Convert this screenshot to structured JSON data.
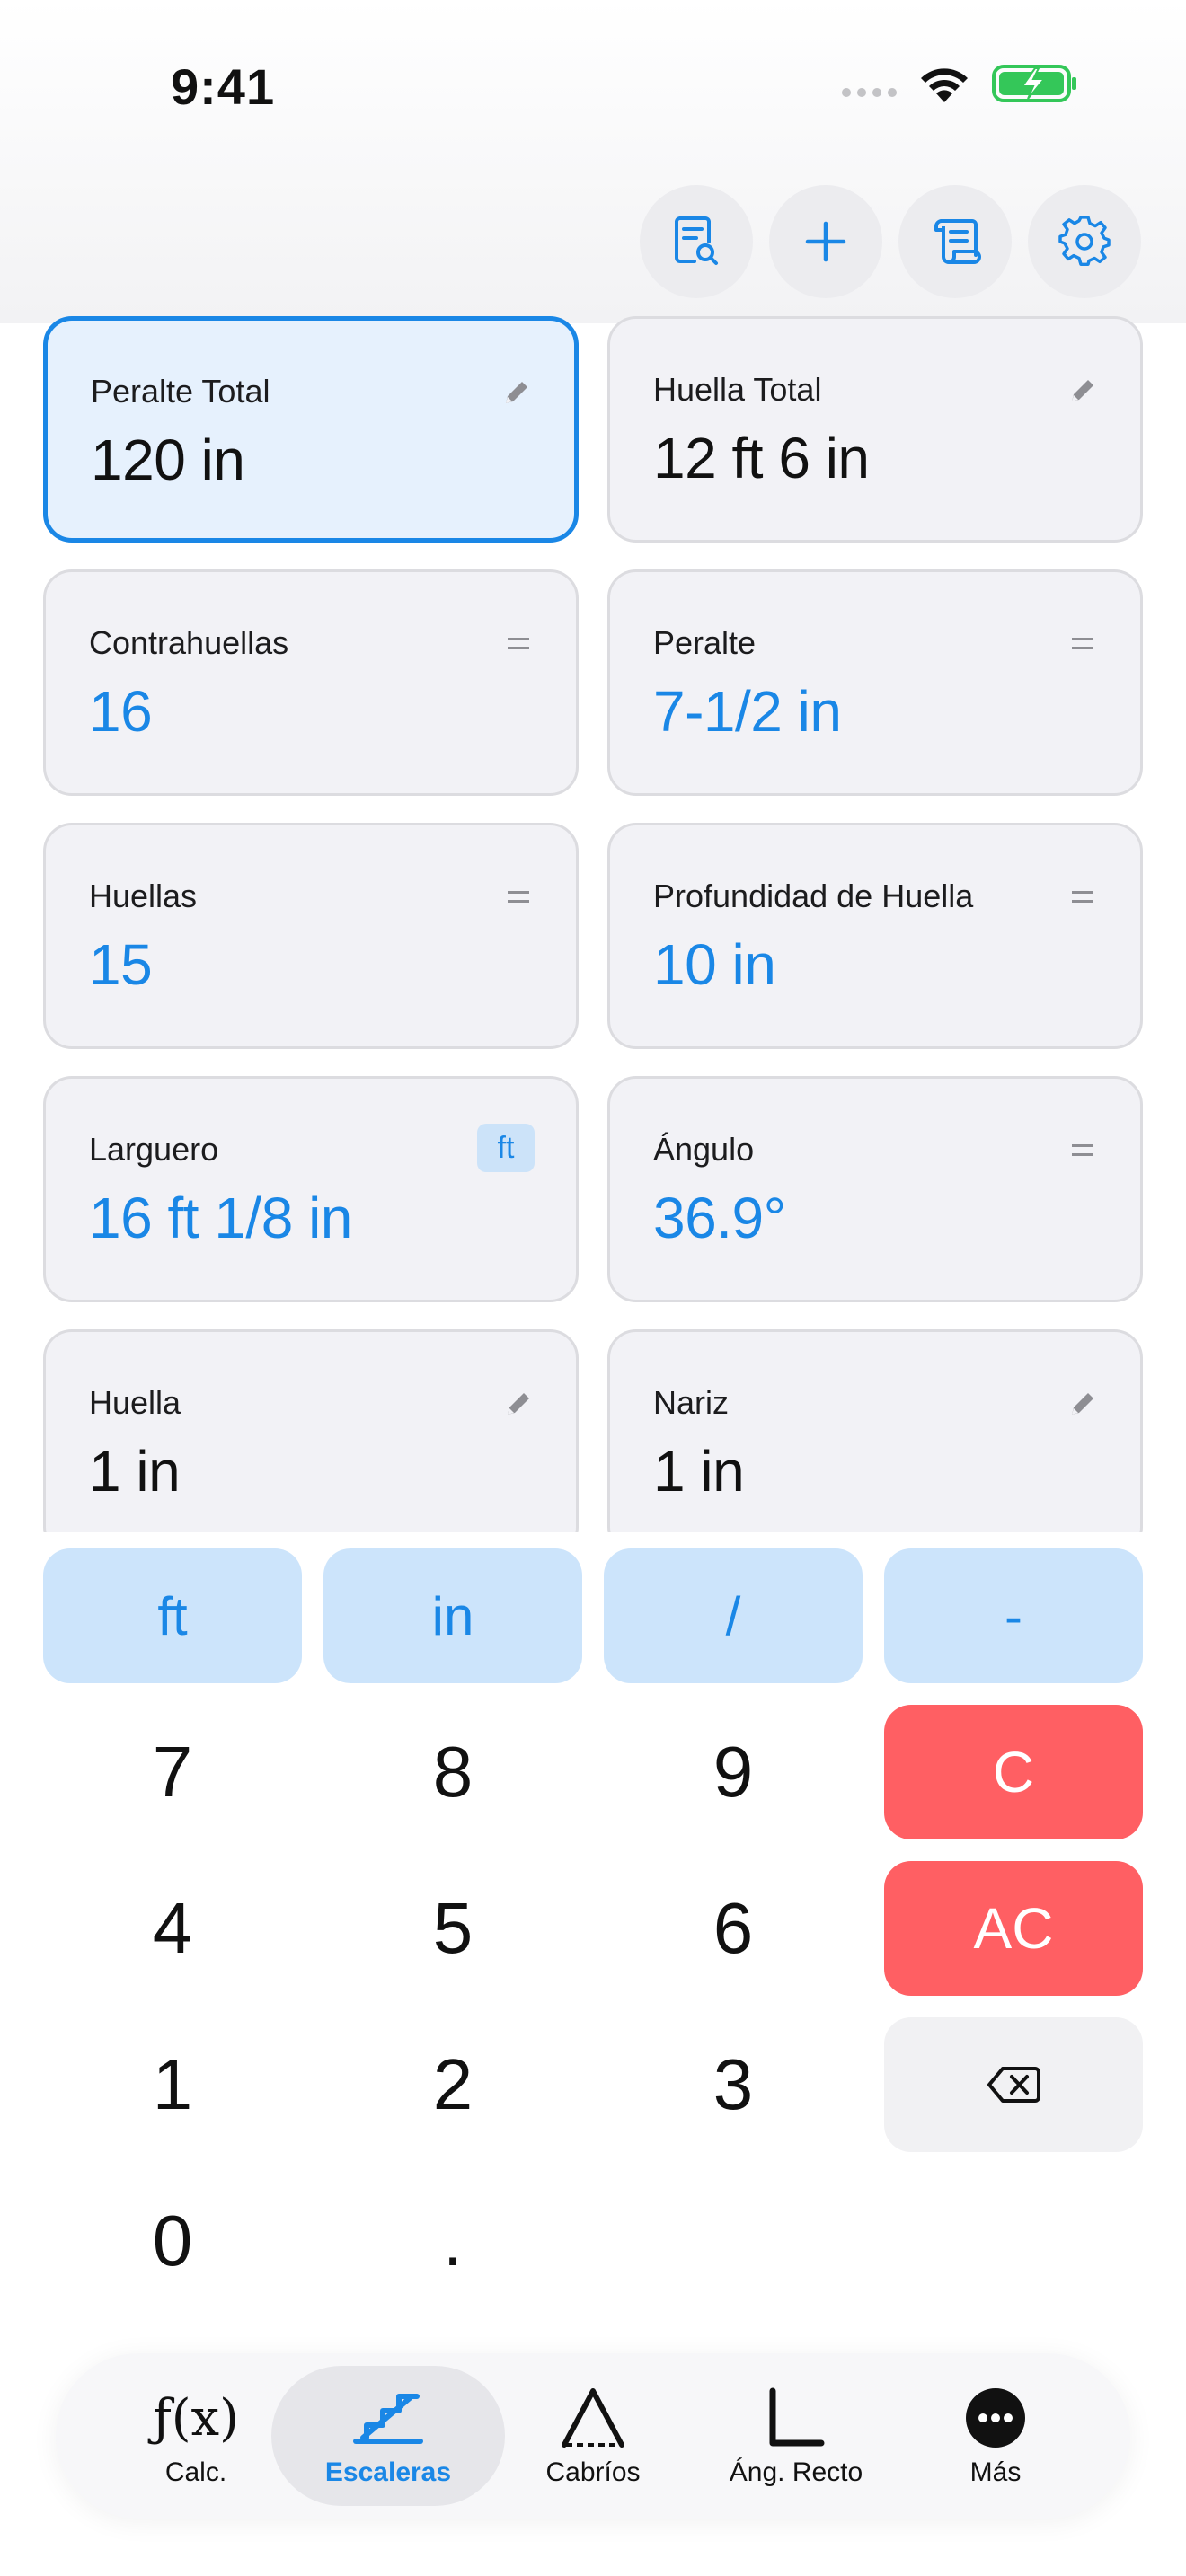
{
  "status_bar": {
    "time": "9:41"
  },
  "toolbar": {
    "buttons": [
      "doc-search-icon",
      "plus-icon",
      "scroll-icon",
      "gear-icon"
    ]
  },
  "cards": [
    {
      "label": "Peralte Total",
      "value": "120 in",
      "kind": "input",
      "active": true
    },
    {
      "label": "Huella Total",
      "value": "12 ft 6 in",
      "kind": "input"
    },
    {
      "label": "Contrahuellas",
      "value": "16",
      "kind": "calc"
    },
    {
      "label": "Peralte",
      "value": "7-1/2 in",
      "kind": "calc"
    },
    {
      "label": "Huellas",
      "value": "15",
      "kind": "calc"
    },
    {
      "label": "Profundidad de Huella",
      "value": "10 in",
      "kind": "calc"
    },
    {
      "label": "Larguero",
      "value": "16 ft 1/8 in",
      "kind": "calc",
      "badge": "ft"
    },
    {
      "label": "Ángulo",
      "value": "36.9°",
      "kind": "calc"
    },
    {
      "label": "Huella",
      "value": "1 in",
      "kind": "input"
    },
    {
      "label": "Nariz",
      "value": "1 in",
      "kind": "input"
    }
  ],
  "keypad": {
    "units": [
      "ft",
      "in",
      "/",
      "-"
    ],
    "digits": {
      "d7": "7",
      "d8": "8",
      "d9": "9",
      "d4": "4",
      "d5": "5",
      "d6": "6",
      "d1": "1",
      "d2": "2",
      "d3": "3",
      "d0": "0",
      "dot": "."
    },
    "clear": "C",
    "all_clear": "AC"
  },
  "tabbar": {
    "tabs": [
      {
        "label": "Calc.",
        "icon_text": "ƒ(x)"
      },
      {
        "label": "Escaleras",
        "active": true
      },
      {
        "label": "Cabríos"
      },
      {
        "label": "Áng. Recto"
      },
      {
        "label": "Más"
      }
    ]
  },
  "colors": {
    "accent": "#1a87e6",
    "danger": "#ff5f63",
    "unit_key_bg": "#cce4fb",
    "battery": "#34c759"
  }
}
